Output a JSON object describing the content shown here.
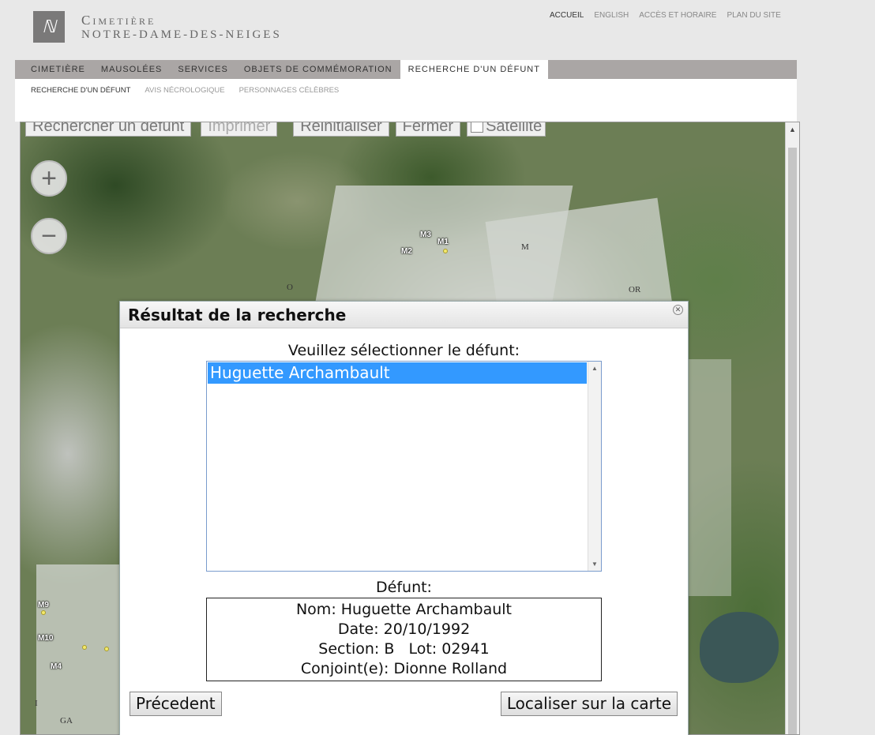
{
  "header": {
    "logo_glyph": "ℕ",
    "brand_line1": "Cimetière",
    "brand_line2": "NOTRE-DAME-DES-NEIGES"
  },
  "topnav": {
    "items": [
      "ACCUEIL",
      "ENGLISH",
      "ACCÈS ET HORAIRE",
      "PLAN DU SITE"
    ],
    "active": "ACCUEIL"
  },
  "mainnav": {
    "items": [
      "CIMETIÈRE",
      "MAUSOLÉES",
      "SERVICES",
      "OBJETS DE COMMÉMORATION",
      "RECHERCHE D'UN DÉFUNT"
    ],
    "active": "RECHERCHE D'UN DÉFUNT"
  },
  "subnav": {
    "items": [
      "RECHERCHE D'UN DÉFUNT",
      "AVIS NÉCROLOGIQUE",
      "PERSONNAGES CÉLÈBRES"
    ],
    "active": "RECHERCHE D'UN DÉFUNT"
  },
  "map_toolbar": {
    "search": "Rechercher un défunt",
    "print": "Imprimer",
    "reset": "Réinitialiser",
    "close": "Fermer",
    "satellite": "Satellite"
  },
  "map_labels": {
    "m3": "M3",
    "m1": "M1",
    "m2": "M2",
    "m": "M",
    "o": "O",
    "or": "OR",
    "m9": "M9",
    "m10": "M10",
    "m4": "M4",
    "i": "I",
    "ga": "GA"
  },
  "dialog": {
    "title": "Résultat de la recherche",
    "prompt": "Veuillez sélectionner le défunt:",
    "options": [
      "Huguette Archambault"
    ],
    "selected": "Huguette Archambault",
    "defunt_label": "Défunt:",
    "info": {
      "nom": "Nom: Huguette Archambault",
      "date": "Date: 20/10/1992",
      "section_lot": "Section: B   Lot: 02941",
      "conjoint": "Conjoint(e): Dionne Rolland"
    },
    "prev_button": "Précedent",
    "locate_button": "Localiser sur la carte"
  }
}
